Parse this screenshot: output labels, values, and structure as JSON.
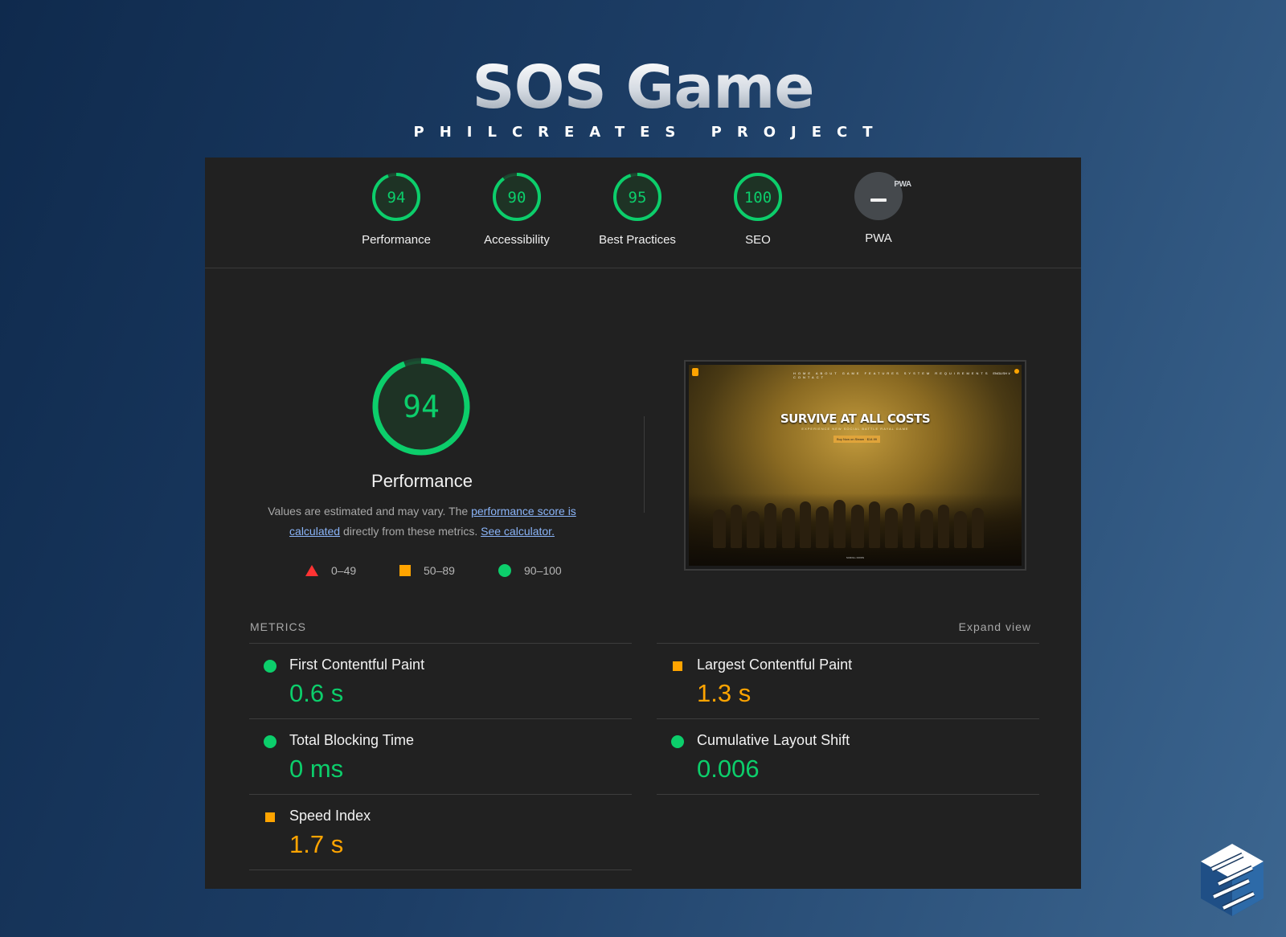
{
  "header": {
    "title": "SOS Game",
    "subtitle": "PHILCREATES PROJECT"
  },
  "categories": [
    {
      "label": "Performance",
      "score": "94",
      "value": 94
    },
    {
      "label": "Accessibility",
      "score": "90",
      "value": 90
    },
    {
      "label": "Best Practices",
      "score": "95",
      "value": 95
    },
    {
      "label": "SEO",
      "score": "100",
      "value": 100
    },
    {
      "label": "PWA",
      "badge_text": "PWA"
    }
  ],
  "performance": {
    "score": "94",
    "value": 94,
    "title": "Performance",
    "desc_prefix": "Values are estimated and may vary. The ",
    "desc_link1": "performance score is calculated",
    "desc_middle": " directly from these metrics. ",
    "desc_link2": "See calculator."
  },
  "legend": [
    {
      "range": "0–49",
      "color": "#ff3333",
      "shape": "triangle"
    },
    {
      "range": "50–89",
      "color": "#ffa400",
      "shape": "square"
    },
    {
      "range": "90–100",
      "color": "#0cce6b",
      "shape": "circle"
    }
  ],
  "screenshot": {
    "headline": "SURVIVE AT ALL COSTS",
    "subline": "EXPERIENCE NEW SOCIAL BATTLE RAYAL GAME",
    "button": "Buy Now on Steam · $14.99",
    "nav": "HOME ABOUT GAME FEATURES SYSTEM REQUIREMENTS CONTACT",
    "lang": "ENGLISH ∨",
    "footer": "SCROLL DOWN"
  },
  "metrics": {
    "label": "METRICS",
    "expand": "Expand view",
    "items": [
      {
        "title": "First Contentful Paint",
        "value": "0.6 s",
        "status": "good"
      },
      {
        "title": "Largest Contentful Paint",
        "value": "1.3 s",
        "status": "average"
      },
      {
        "title": "Total Blocking Time",
        "value": "0 ms",
        "status": "good"
      },
      {
        "title": "Cumulative Layout Shift",
        "value": "0.006",
        "status": "good"
      },
      {
        "title": "Speed Index",
        "value": "1.7 s",
        "status": "average"
      }
    ]
  },
  "colors": {
    "good": "#0cce6b",
    "average": "#ffa400",
    "poor": "#ff3333",
    "panel": "#212121"
  }
}
